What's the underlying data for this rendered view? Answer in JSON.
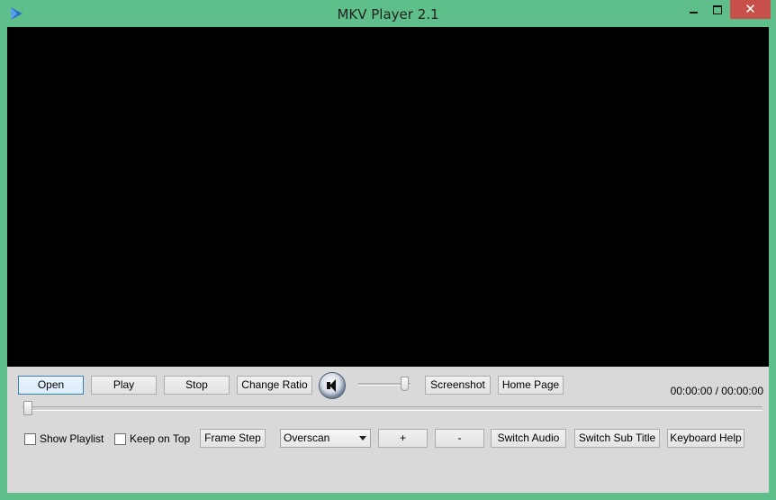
{
  "window": {
    "title": "MKV Player 2.1",
    "close_glyph": "✕",
    "frame_color": "#5ebf8a",
    "close_color": "#c7504a"
  },
  "controls": {
    "open": "Open",
    "play": "Play",
    "stop": "Stop",
    "change_ratio": "Change Ratio",
    "screenshot": "Screenshot",
    "home_page": "Home Page",
    "frame_step": "Frame Step",
    "plus": "+",
    "minus": "-",
    "switch_audio": "Switch Audio",
    "switch_sub_title": "Switch Sub Title",
    "keyboard_help": "Keyboard Help",
    "show_playlist": "Show Playlist",
    "keep_on_top": "Keep on Top",
    "video_mode": "Overscan"
  },
  "status": {
    "time": "00:00:00 / 00:00:00"
  },
  "icons": {
    "app": "play-triangle-icon",
    "volume": "speaker-icon"
  }
}
